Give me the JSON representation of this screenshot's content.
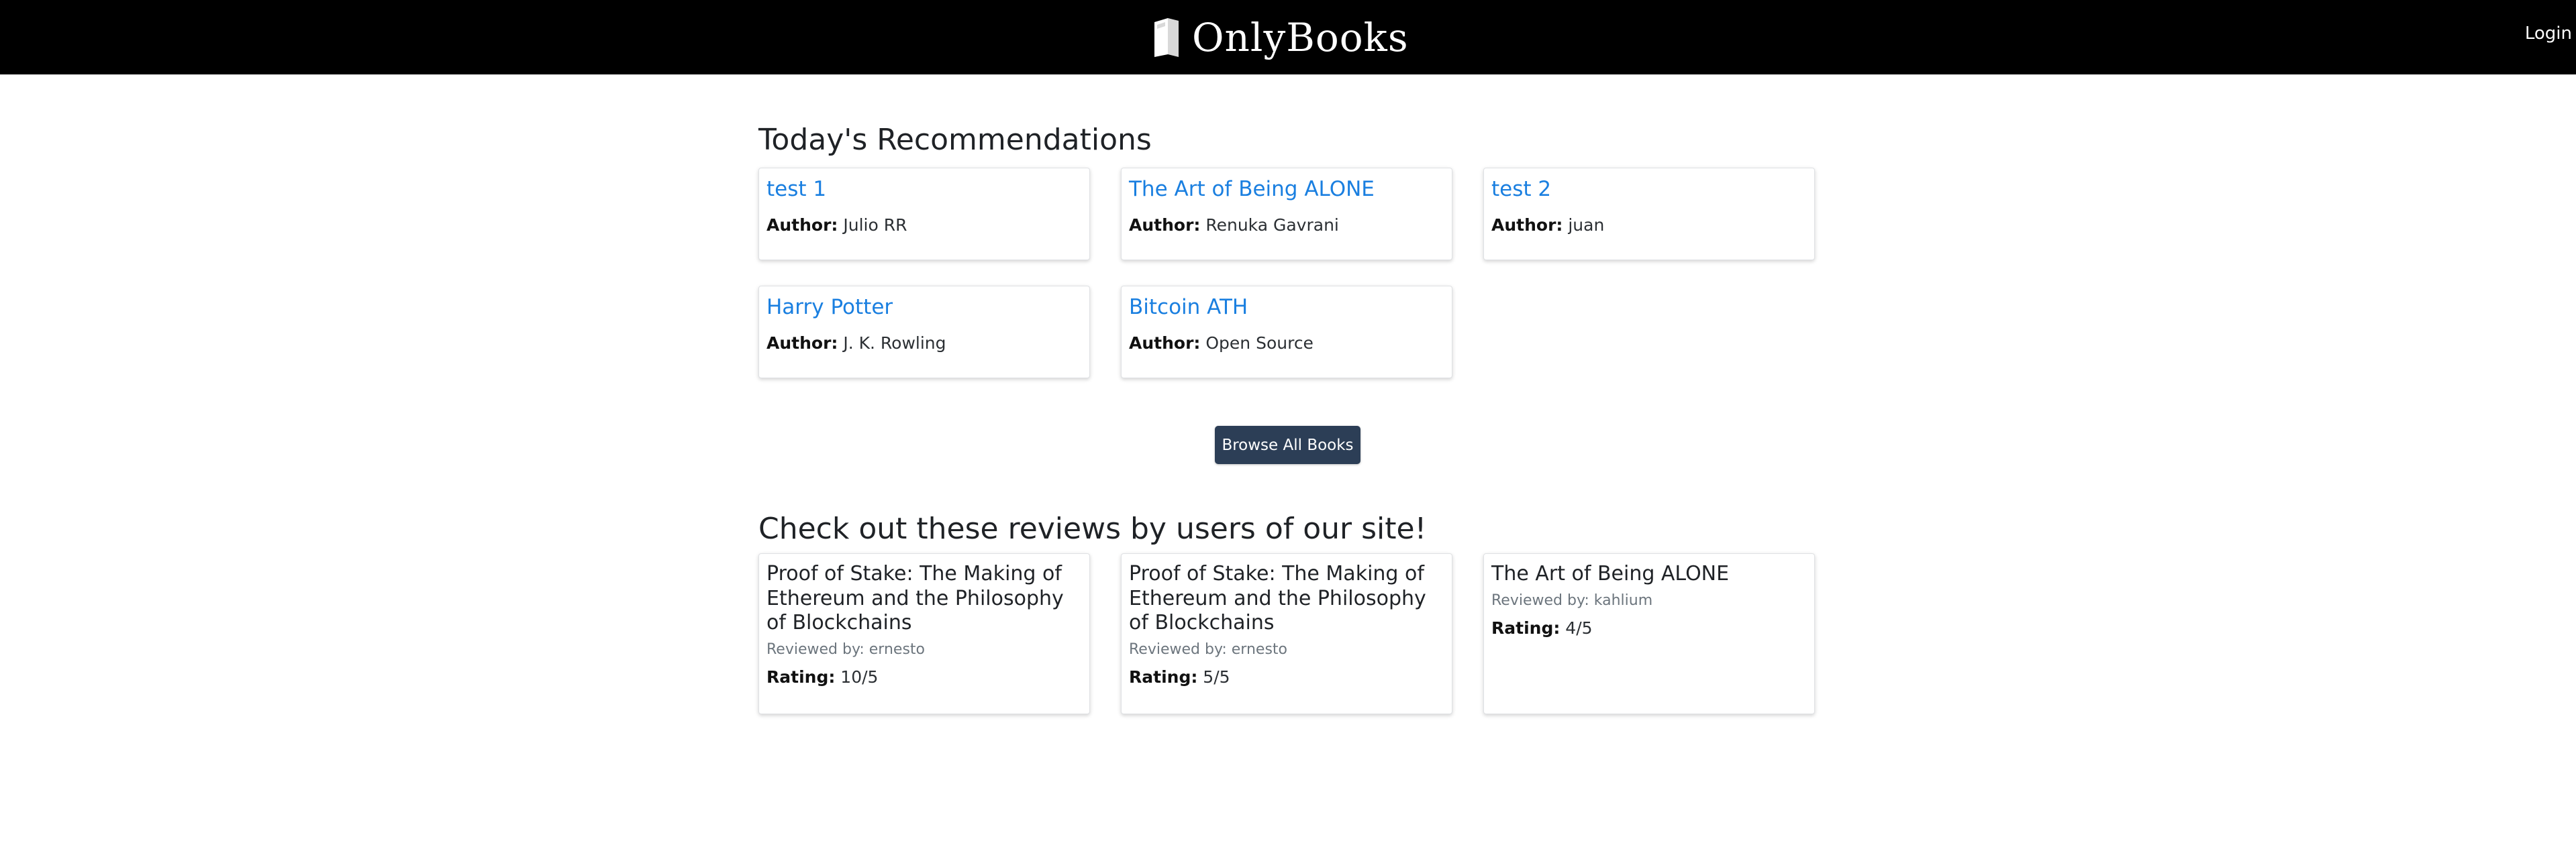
{
  "navbar": {
    "brand_name": "OnlyBooks",
    "brand_icon": "book-icon",
    "login_label": "Login"
  },
  "recommendations": {
    "heading": "Today's Recommendations",
    "author_label": "Author:",
    "books": [
      {
        "title": "test 1",
        "author": "Julio RR"
      },
      {
        "title": "The Art of Being ALONE",
        "author": "Renuka Gavrani"
      },
      {
        "title": "test 2",
        "author": "juan"
      },
      {
        "title": "Harry Potter",
        "author": "J. K. Rowling"
      },
      {
        "title": "Bitcoin ATH",
        "author": "Open Source"
      }
    ]
  },
  "browse_button_label": "Browse All Books",
  "reviews": {
    "heading": "Check out these reviews by users of our site!",
    "rating_label": "Rating:",
    "items": [
      {
        "title": "Proof of Stake: The Making of Ethereum and the Philosophy of Blockchains",
        "reviewed_by": "Reviewed by: ernesto",
        "rating": "10/5"
      },
      {
        "title": "Proof of Stake: The Making of Ethereum and the Philosophy of Blockchains",
        "reviewed_by": "Reviewed by: ernesto",
        "rating": "5/5"
      },
      {
        "title": "The Art of Being ALONE",
        "reviewed_by": "Reviewed by: kahlium",
        "rating": "4/5"
      }
    ]
  },
  "colors": {
    "navbar_bg": "#000000",
    "link": "#1a7fe0",
    "button_bg": "#2c3e56"
  }
}
